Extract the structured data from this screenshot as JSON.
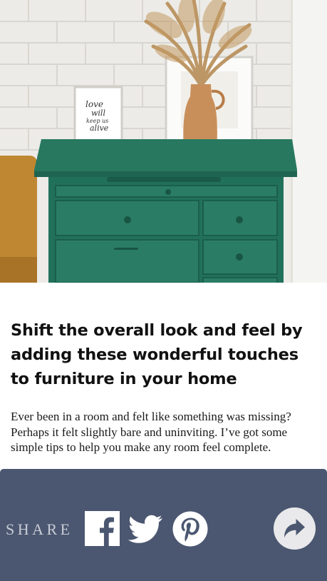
{
  "article": {
    "headline": "Shift the overall look and feel by adding these wonderful touches to furniture in your home",
    "excerpt": "Ever been in a room and felt like something was missing? Perhaps it felt slightly bare and uninviting. I’ve got some simple tips to help you make any room feel complete."
  },
  "hero": {
    "frame_text_lines": [
      "love",
      "will",
      "keep us",
      "alive"
    ],
    "colors": {
      "wall": "#ecebe7",
      "dresser": "#24725b",
      "vase": "#c98f5a",
      "sofa": "#c08732"
    }
  },
  "share": {
    "label": "SHARE",
    "bar_color": "#4b5770",
    "buttons": [
      "facebook-icon",
      "twitter-icon",
      "pinterest-icon",
      "forward-icon"
    ]
  }
}
